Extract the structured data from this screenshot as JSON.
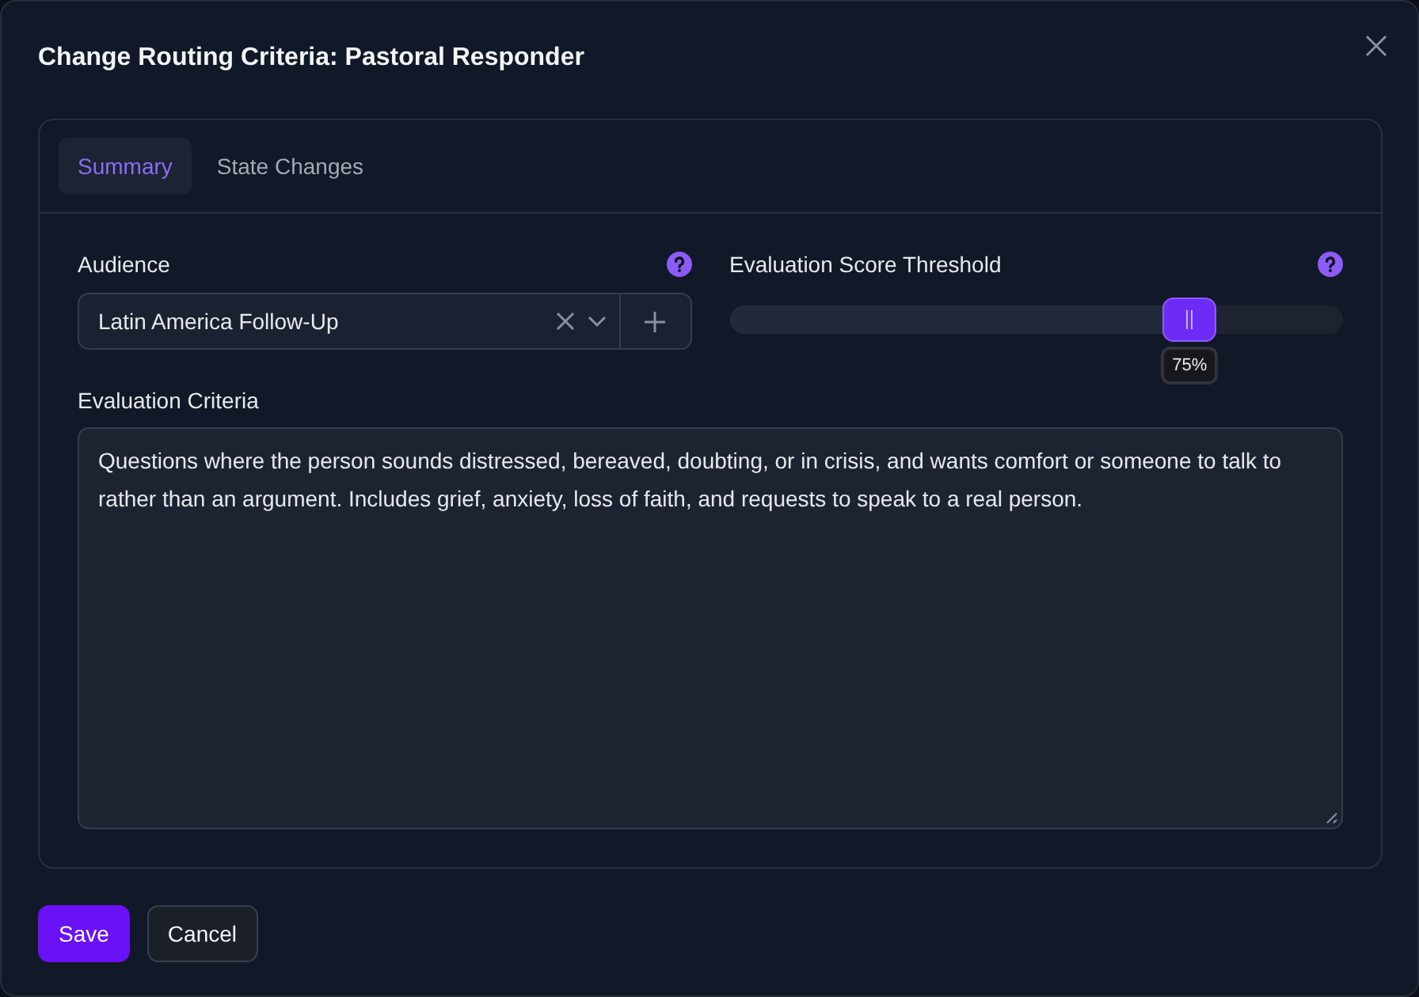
{
  "dialog": {
    "title": "Change Routing Criteria: Pastoral Responder"
  },
  "tabs": [
    {
      "label": "Summary",
      "selected": true
    },
    {
      "label": "State Changes",
      "selected": false
    }
  ],
  "audience": {
    "label": "Audience",
    "value": "Latin America Follow-Up"
  },
  "threshold": {
    "label": "Evaluation Score Threshold",
    "level": 0.75,
    "reading": "75%"
  },
  "criteria": {
    "label": "Evaluation Criteria",
    "value": "Questions where the person sounds distressed, bereaved, doubting, or in crisis, and wants comfort or someone to talk to rather than an argument. Includes grief, anxiety, loss of faith, and requests to speak to a real person."
  },
  "buttons": [
    {
      "label": "Save",
      "kind": "primary"
    },
    {
      "label": "Cancel",
      "kind": "secondary"
    }
  ]
}
